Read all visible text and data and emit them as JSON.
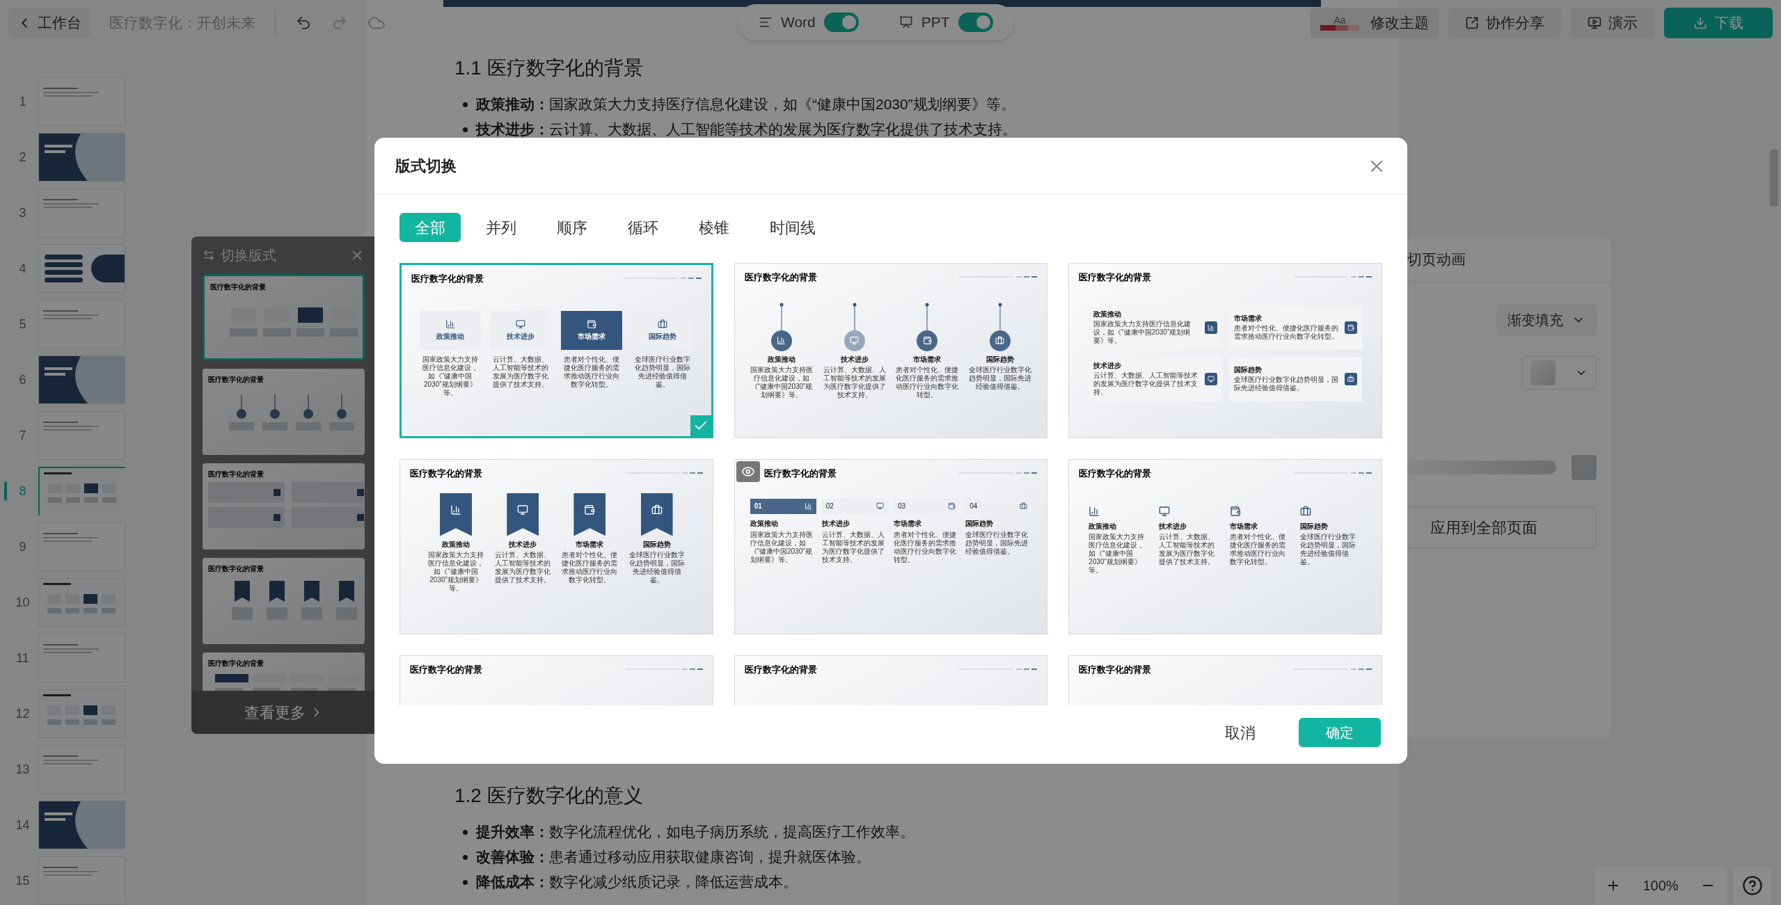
{
  "topbar": {
    "back": "工作台",
    "doc_title": "医疗数字化：开创未来",
    "modes": [
      {
        "label": "Word",
        "kind": "word",
        "on": true
      },
      {
        "label": "PPT",
        "kind": "ppt",
        "on": true
      }
    ],
    "theme": {
      "swatch": "Aa",
      "label": "修改主题"
    },
    "actions": [
      {
        "label": "协作分享",
        "kind": "share"
      },
      {
        "label": "演示",
        "kind": "present"
      },
      {
        "label": "下载",
        "kind": "download"
      }
    ]
  },
  "slides": [
    {
      "number": "1",
      "kind": "plain",
      "selected": false
    },
    {
      "number": "2",
      "kind": "cover",
      "selected": false
    },
    {
      "number": "3",
      "kind": "plain",
      "selected": false
    },
    {
      "number": "4",
      "kind": "toc",
      "selected": false
    },
    {
      "number": "5",
      "kind": "plain",
      "selected": false
    },
    {
      "number": "6",
      "kind": "cover",
      "selected": false
    },
    {
      "number": "7",
      "kind": "plain",
      "selected": false
    },
    {
      "number": "8",
      "kind": "cards",
      "selected": true
    },
    {
      "number": "9",
      "kind": "plain",
      "selected": false
    },
    {
      "number": "10",
      "kind": "cards",
      "selected": false
    },
    {
      "number": "11",
      "kind": "plain",
      "selected": false
    },
    {
      "number": "12",
      "kind": "cards",
      "selected": false
    },
    {
      "number": "13",
      "kind": "plain",
      "selected": false
    },
    {
      "number": "14",
      "kind": "cover",
      "selected": false
    },
    {
      "number": "15",
      "kind": "plain",
      "selected": false
    }
  ],
  "document": {
    "sections": [
      {
        "heading": "1.1 医疗数字化的背景",
        "bullets": [
          "**政策推动：**国家政策大力支持医疗信息化建设，如《“健康中国2030”规划纲要》等。",
          "**技术进步：**云计算、大数据、人工智能等技术的发展为医疗数字化提供了技术支持。"
        ]
      },
      {
        "heading": "1.2 医疗数字化的意义",
        "bullets": [
          "**提升效率：**数字化流程优化，如电子病历系统，提高医疗工作效率。",
          "**改善体验：**患者通过移动应用获取健康咨询，提升就医体验。",
          "**降低成本：**数字化减少纸质记录，降低运营成本。"
        ]
      }
    ]
  },
  "layout_panel": {
    "title": "切换版式",
    "more": "查看更多",
    "cards": [
      {
        "title": "医疗数字化的背景",
        "kind": "icon-card",
        "selected": true
      },
      {
        "title": "医疗数字化的背景",
        "kind": "timeline-pin",
        "selected": false
      },
      {
        "title": "医疗数字化的背景",
        "kind": "two-column",
        "selected": false
      },
      {
        "title": "医疗数字化的背景",
        "kind": "ribbon",
        "selected": false
      },
      {
        "title": "医疗数字化的背景",
        "kind": "numbered-tab",
        "selected": false
      }
    ]
  },
  "animation_panel": {
    "title": "切页动画",
    "fill": "渐变填充",
    "apply": "应用到全部页面"
  },
  "zoom": {
    "value": "100%"
  },
  "dialog": {
    "title": "版式切换",
    "tabs": [
      {
        "label": "全部",
        "selected": true
      },
      {
        "label": "并列",
        "selected": false
      },
      {
        "label": "顺序",
        "selected": false
      },
      {
        "label": "循环",
        "selected": false
      },
      {
        "label": "棱锥",
        "selected": false
      },
      {
        "label": "时间线",
        "selected": false
      }
    ],
    "layouts": [
      {
        "title": "医疗数字化的背景",
        "kind": "icon-card",
        "selected": true,
        "items": [
          {
            "label": "政策推动",
            "text": "国家政策大力支持医疗信息化建设，如《“健康中国2030”规划纲要》等。",
            "highlighted": false
          },
          {
            "label": "技术进步",
            "text": "云计算、大数据、人工智能等技术的发展为医疗数字化提供了技术支持。",
            "highlighted": false
          },
          {
            "label": "市场需求",
            "text": "患者对个性化、便捷化医疗服务的需求推动医疗行业向数字化转型。",
            "highlighted": true
          },
          {
            "label": "国际趋势",
            "text": "全球医疗行业数字化趋势明显，国际先进经验值得借鉴。",
            "highlighted": false
          }
        ]
      },
      {
        "title": "医疗数字化的背景",
        "kind": "timeline-pin",
        "selected": false,
        "items": [
          {
            "label": "政策推动",
            "text": "国家政策大力支持医疗信息化建设，如《“健康中国2030”规划纲要》等。"
          },
          {
            "label": "技术进步",
            "text": "云计算、大数据、人工智能等技术的发展为医疗数字化提供了技术支持。"
          },
          {
            "label": "市场需求",
            "text": "患者对个性化、便捷化医疗服务的需求推动医疗行业向数字化转型。"
          },
          {
            "label": "国际趋势",
            "text": "全球医疗行业数字化趋势明显，国际先进经验值得借鉴。"
          }
        ]
      },
      {
        "title": "医疗数字化的背景",
        "kind": "two-column",
        "selected": false,
        "items": [
          {
            "label": "政策推动",
            "text": "国家政策大力支持医疗信息化建设，如《“健康中国2030”规划纲要》等。"
          },
          {
            "label": "市场需求",
            "text": "患者对个性化、便捷化医疗服务的需求推动医疗行业向数字化转型。"
          },
          {
            "label": "技术进步",
            "text": "云计算、大数据、人工智能等技术的发展为医疗数字化提供了技术支持。"
          },
          {
            "label": "国际趋势",
            "text": "全球医疗行业数字化趋势明显，国际先进经验值得借鉴。"
          }
        ]
      },
      {
        "title": "医疗数字化的背景",
        "kind": "ribbon",
        "selected": false,
        "items": [
          {
            "label": "政策推动",
            "text": "国家政策大力支持医疗信息化建设，如《“健康中国2030”规划纲要》等。"
          },
          {
            "label": "技术进步",
            "text": "云计算、大数据、人工智能等技术的发展为医疗数字化提供了技术支持。"
          },
          {
            "label": "市场需求",
            "text": "患者对个性化、便捷化医疗服务的需求推动医疗行业向数字化转型。"
          },
          {
            "label": "国际趋势",
            "text": "全球医疗行业数字化趋势明显，国际先进经验值得借鉴。"
          }
        ]
      },
      {
        "title": "医疗数字化的背景",
        "kind": "numbered-tab",
        "selected": false,
        "preview": true,
        "items": [
          {
            "number": "01",
            "label": "政策推动",
            "text": "国家政策大力支持医疗信息化建设，如《“健康中国2030”规划纲要》等。",
            "highlighted": true
          },
          {
            "number": "02",
            "label": "技术进步",
            "text": "云计算、大数据、人工智能等技术的发展为医疗数字化提供了技术支持。",
            "highlighted": false
          },
          {
            "number": "03",
            "label": "市场需求",
            "text": "患者对个性化、便捷化医疗服务的需求推动医疗行业向数字化转型。",
            "highlighted": false
          },
          {
            "number": "04",
            "label": "国际趋势",
            "text": "全球医疗行业数字化趋势明显，国际先进经验值得借鉴。",
            "highlighted": false
          }
        ]
      },
      {
        "title": "医疗数字化的背景",
        "kind": "icon-plain",
        "selected": false,
        "items": [
          {
            "label": "政策推动",
            "text": "国家政策大力支持医疗信息化建设，如《“健康中国2030”规划纲要》等。"
          },
          {
            "label": "技术进步",
            "text": "云计算、大数据、人工智能等技术的发展为医疗数字化提供了技术支持。"
          },
          {
            "label": "市场需求",
            "text": "患者对个性化、便捷化医疗服务的需求推动医疗行业向数字化转型。"
          },
          {
            "label": "国际趋势",
            "text": "全球医疗行业数字化趋势明显，国际先进经验值得借鉴。"
          }
        ]
      },
      {
        "title": "医疗数字化的背景",
        "kind": "partial",
        "selected": false
      },
      {
        "title": "医疗数字化的背景",
        "kind": "partial",
        "selected": false
      },
      {
        "title": "医疗数字化的背景",
        "kind": "partial",
        "selected": false
      }
    ],
    "cancel": "取消",
    "confirm": "确定"
  }
}
